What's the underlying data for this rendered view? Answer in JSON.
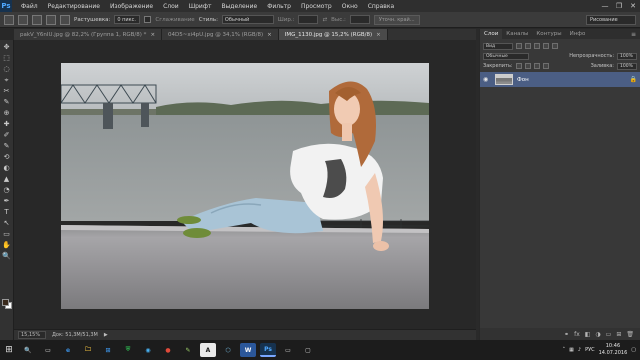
{
  "app": {
    "logo": "Ps",
    "menu": [
      "Файл",
      "Редактирование",
      "Изображение",
      "Слои",
      "Шрифт",
      "Выделение",
      "Фильтр",
      "Просмотр",
      "Окно",
      "Справка"
    ],
    "window_controls": [
      "—",
      "❐",
      "✕"
    ]
  },
  "options": {
    "feather_label": "Растушевка:",
    "feather_value": "0 пикс.",
    "antialias_label": "Сглаживание",
    "style_label": "Стиль:",
    "style_value": "Обычный",
    "width_label": "Шир.:",
    "height_label": "Выс.:",
    "refine_edge_label": "Уточн. край...",
    "workspace": "Рисование"
  },
  "tabs": [
    {
      "label": "pakV_Y6nIU.jpg @ 82,2% (Группа 1, RGB/8) *",
      "active": false
    },
    {
      "label": "04D5~xi4pU.jpg @ 34,1% (RGB/8)",
      "active": false
    },
    {
      "label": "IMG_1130.jpg @ 15,2% (RGB/8)",
      "active": true
    }
  ],
  "tools": [
    "✥",
    "⬚",
    "◌",
    "⌖",
    "✂",
    "✎",
    "⊕",
    "✚",
    "✐",
    "✎",
    "⟲",
    "◐",
    "▲",
    "◔",
    "✒",
    "T",
    "↖",
    "▭",
    "✋",
    "🔍"
  ],
  "status": {
    "zoom": "15,15%",
    "doc": "Док: 51,3M/51,3M",
    "arrow": "▶"
  },
  "panel": {
    "tabs": [
      "Слои",
      "Каналы",
      "Контуры",
      "Инфо"
    ],
    "menu_icon": "≡",
    "kind_label": "Вид",
    "blend_mode": "Обычные",
    "opacity_label": "Непрозрачность:",
    "opacity_value": "100%",
    "lock_label": "Закрепить:",
    "fill_label": "Заливка:",
    "fill_value": "100%",
    "layer_name": "Фон",
    "footer_icons": [
      "⚭",
      "fx",
      "◧",
      "◑",
      "▭",
      "⊞",
      "🗑"
    ]
  },
  "taskbar": {
    "start": "⊞",
    "apps": [
      "🔍",
      "▭",
      "e",
      "🗀",
      "⊞",
      "⛨",
      "◉",
      "●",
      "✎",
      "A",
      "⬡",
      "W",
      "Ps",
      "▭",
      "▢"
    ],
    "lang": "РУС",
    "time": "10:46",
    "date": "14.07.2016"
  },
  "colors": {
    "accent": "#4fa8ff",
    "layer_selected": "#4b5e84",
    "foreground": "#3a2a1c",
    "background": "#ffffff"
  }
}
